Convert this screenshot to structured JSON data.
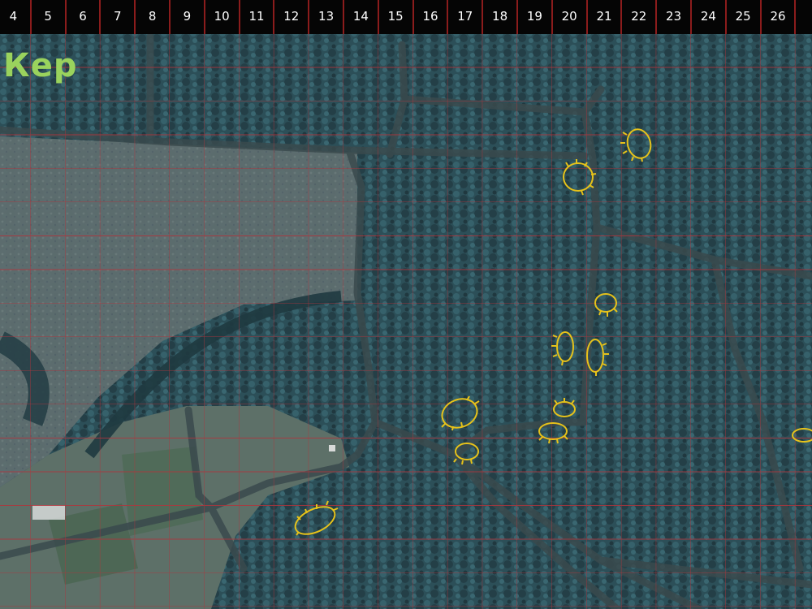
{
  "map": {
    "title_label": "Кер",
    "type": "satellite imagery with grid overlay",
    "grid_color": "#b0343c",
    "header_background": "#050505",
    "header_text_color": "#ffffff",
    "label_color": "#9ad35d",
    "marker_color": "#e6c21a",
    "columns": [
      "4",
      "5",
      "6",
      "7",
      "8",
      "9",
      "10",
      "11",
      "12",
      "13",
      "14",
      "15",
      "16",
      "17",
      "18",
      "19",
      "20",
      "21",
      "22",
      "23",
      "24",
      "25",
      "26"
    ],
    "marker_count": 11
  }
}
